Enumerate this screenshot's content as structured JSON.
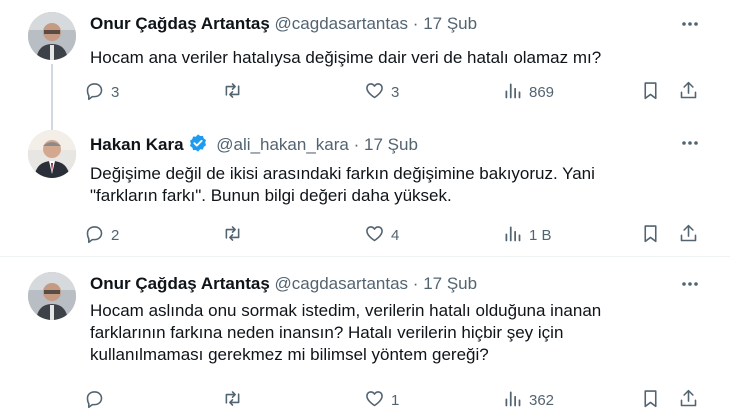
{
  "tweets": [
    {
      "name": "Onur Çağdaş Artantaş",
      "handle": "@cagdasartantas",
      "sep": "·",
      "date": "17 Şub",
      "lines": [
        "Hocam ana veriler hatalıysa değişime dair veri de hatalı olamaz mı?"
      ],
      "replies": "3",
      "retweets": "",
      "likes": "3",
      "views": "869"
    },
    {
      "name": "Hakan Kara",
      "handle": "@ali_hakan_kara",
      "sep": "·",
      "date": "17 Şub",
      "lines": [
        "Değişime değil de ikisi arasındaki farkın değişimine bakıyoruz. Yani",
        "\"farkların farkı\". Bunun bilgi değeri daha yüksek."
      ],
      "replies": "2",
      "retweets": "",
      "likes": "4",
      "views": "1 B"
    },
    {
      "name": "Onur Çağdaş Artantaş",
      "handle": "@cagdasartantas",
      "sep": "·",
      "date": "17 Şub",
      "lines": [
        "Hocam aslında onu sormak istedim, verilerin hatalı olduğuna inanan",
        "farklarının farkına neden inansın? Hatalı verilerin hiçbir şey için",
        "kullanılmaması gerekmez mi bilimsel yöntem gereği?"
      ],
      "replies": "",
      "retweets": "",
      "likes": "1",
      "views": "362"
    }
  ],
  "icons": {
    "reply": "reply-icon",
    "retweet": "retweet-icon",
    "like": "heart-icon",
    "views": "views-icon",
    "bookmark": "bookmark-icon",
    "share": "share-icon",
    "more": "more-icon",
    "verified": "verified-badge-icon"
  },
  "colors": {
    "verified": "#1d9bf0",
    "muted": "#536471",
    "text": "#0f1419"
  }
}
